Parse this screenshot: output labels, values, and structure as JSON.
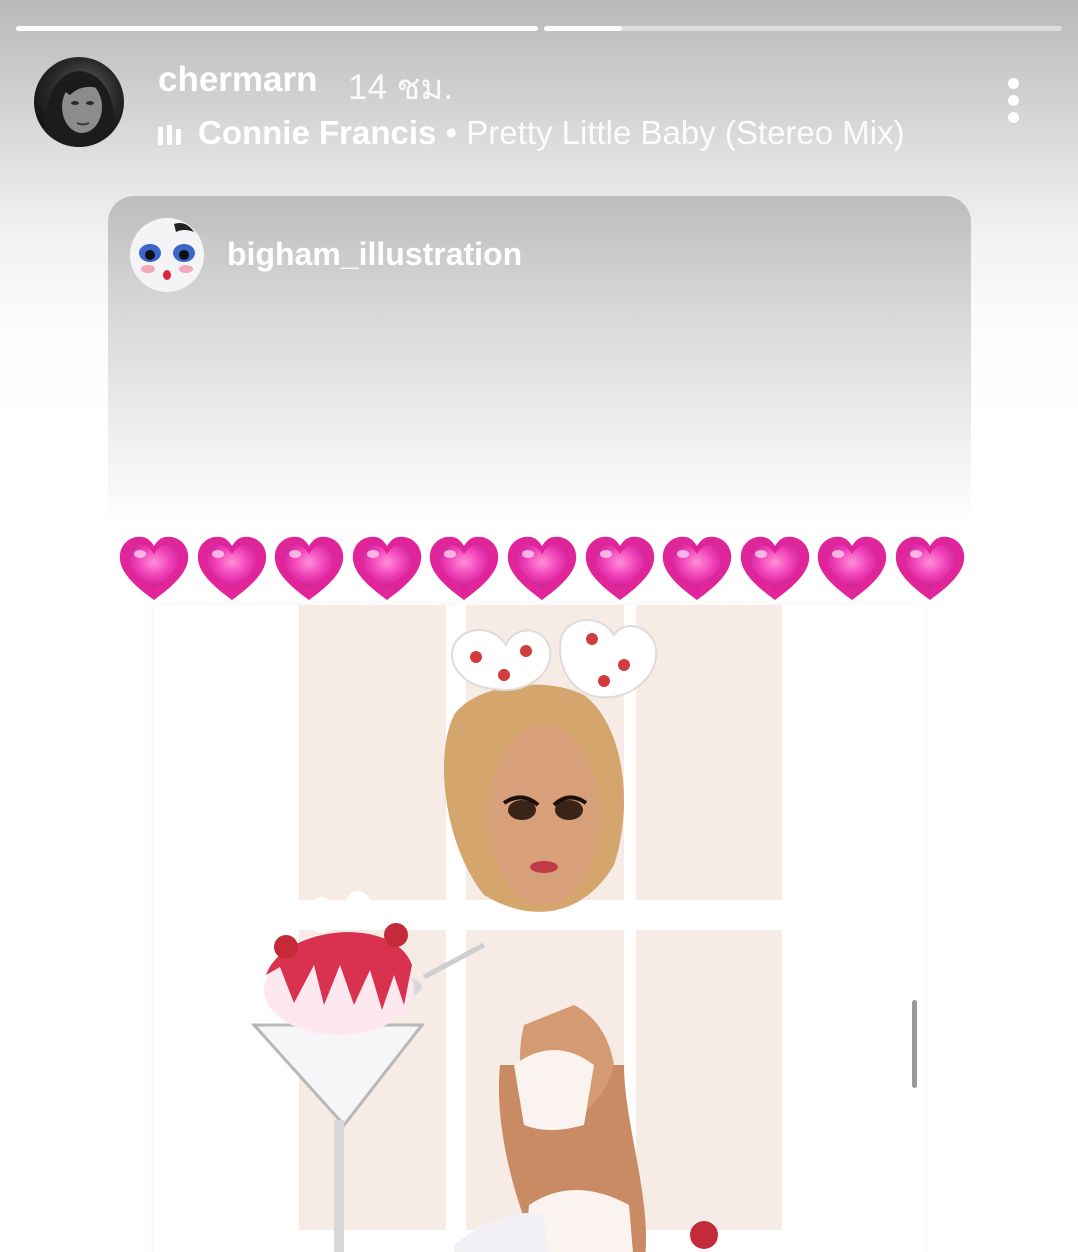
{
  "story": {
    "progress": [
      1.0,
      0.15
    ]
  },
  "header": {
    "username": "chermarn",
    "time": "14 ชม.",
    "music": {
      "artist": "Connie Francis",
      "separator": "•",
      "song": "Pretty Little Baby (Stereo Mix)"
    },
    "more_icon": "three-dots-vertical-icon"
  },
  "shared_post": {
    "username": "bigham_illustration",
    "caption_emoji": "💗💗💗💗💗💗💗💗💗💗💗",
    "heart_count": 11,
    "heart_color": "#e0259b",
    "image": "illustration-woman-strawberry-dessert"
  }
}
